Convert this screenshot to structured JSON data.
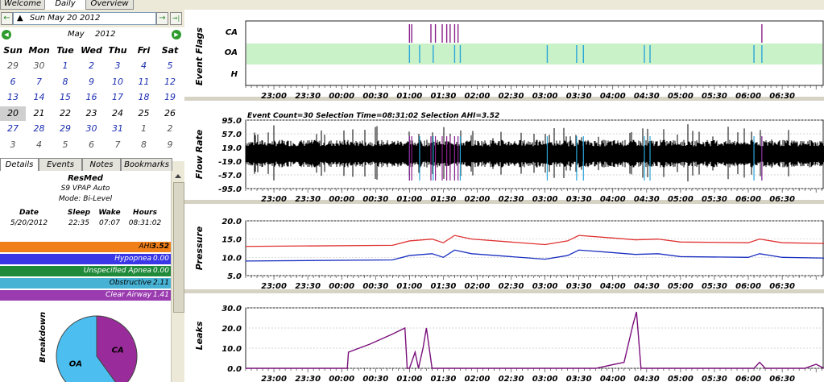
{
  "tabs": [
    "Welcome",
    "Daily",
    "Overview"
  ],
  "date_nav": {
    "date": "Sun May 20 2012",
    "back_glyph": "←",
    "forward_glyph": "→",
    "latest_glyph": "→|",
    "dropdown_glyph": "▲"
  },
  "calendar": {
    "month": "May",
    "year": "2012",
    "prev_glyph": "◀",
    "next_glyph": "▶",
    "dows": [
      "Sun",
      "Mon",
      "Tue",
      "Wed",
      "Thu",
      "Fri",
      "Sat"
    ],
    "weeks": [
      [
        "29",
        "30",
        "1",
        "2",
        "3",
        "4",
        "5"
      ],
      [
        "6",
        "7",
        "8",
        "9",
        "10",
        "11",
        "12"
      ],
      [
        "13",
        "14",
        "15",
        "16",
        "17",
        "18",
        "19"
      ],
      [
        "20",
        "21",
        "22",
        "23",
        "24",
        "25",
        "26"
      ],
      [
        "27",
        "28",
        "29",
        "30",
        "31",
        "1",
        "2"
      ],
      [
        "3",
        "4",
        "5",
        "6",
        "7",
        "8",
        "9"
      ]
    ]
  },
  "detail_tabs": [
    "Details",
    "Events",
    "Notes",
    "Bookmarks"
  ],
  "machine": {
    "brand": "ResMed",
    "model": "S9 VPAP Auto",
    "mode": "Mode: Bi-Level"
  },
  "session": {
    "headers": [
      "Date",
      "Sleep",
      "Wake",
      "Hours"
    ],
    "values": [
      "5/20/2012",
      "22:35",
      "07:07",
      "08:31:02"
    ]
  },
  "indices": [
    {
      "label": "AHI",
      "value": "3.52",
      "color": "#f07f1a"
    },
    {
      "label": "Hypopnea",
      "value": "0.00",
      "color": "#3a38e6"
    },
    {
      "label": "Unspecified Apnea",
      "value": "0.00",
      "color": "#1f8a3a"
    },
    {
      "label": "Obstructive",
      "value": "2.11",
      "color": "#47b2d4"
    },
    {
      "label": "Clear Airway",
      "value": "1.41",
      "color": "#9a3bb0"
    }
  ],
  "breakdown": {
    "title": "Breakdown",
    "chart_data": {
      "type": "pie",
      "slices": [
        {
          "label": "CA",
          "value": 40,
          "color": "#9a2b9a"
        },
        {
          "label": "OA",
          "value": 60,
          "color": "#4cbff0"
        }
      ]
    }
  },
  "x_ticks": [
    "23:00",
    "23:30",
    "00:00",
    "00:30",
    "01:00",
    "01:30",
    "02:00",
    "02:30",
    "03:00",
    "03:30",
    "04:00",
    "04:30",
    "05:00",
    "05:30",
    "06:00",
    "06:30"
  ],
  "flags": {
    "title": "Event Flags",
    "rows": [
      "CA",
      "OA",
      "H"
    ],
    "chart_data": {
      "type": "scatter",
      "ca_times": [
        "01:00",
        "01:02",
        "01:19",
        "01:23",
        "01:29",
        "01:33",
        "01:36",
        "01:40",
        "01:43",
        "06:12"
      ],
      "oa_times": [
        "01:00",
        "01:09",
        "01:21",
        "01:40",
        "01:45",
        "03:02",
        "03:28",
        "03:34",
        "04:28",
        "04:33",
        "06:05",
        "06:12"
      ]
    }
  },
  "flow": {
    "title": "Flow Rate",
    "annotation": "Event Count=30 Selection Time=08:31:02 Selection AHI=3.52",
    "y_ticks": [
      "95.0",
      "57.0",
      "19.0",
      "-19.0",
      "-57.0",
      "-95.0"
    ]
  },
  "pressure": {
    "title": "Pressure",
    "y_ticks": [
      "20.0",
      "15.0",
      "10.0",
      "5.0"
    ],
    "colors": {
      "ipap": "#e03030",
      "epap": "#1a2fc0"
    },
    "chart_data": {
      "type": "line",
      "x": [
        "22:35",
        "00:45",
        "01:00",
        "01:20",
        "01:30",
        "01:40",
        "01:55",
        "03:00",
        "03:20",
        "03:30",
        "04:00",
        "04:20",
        "04:40",
        "05:00",
        "06:00",
        "06:10",
        "06:30",
        "07:07"
      ],
      "series": [
        {
          "values": [
            13.0,
            13.3,
            14.5,
            15.0,
            14.0,
            16.0,
            15.0,
            13.5,
            14.5,
            16.0,
            15.3,
            14.8,
            15.0,
            14.2,
            14.0,
            15.0,
            14.0,
            13.8
          ]
        },
        {
          "values": [
            9.0,
            9.3,
            10.5,
            11.0,
            10.0,
            12.0,
            11.0,
            9.5,
            10.5,
            12.0,
            11.3,
            10.8,
            11.0,
            10.2,
            10.0,
            11.0,
            10.0,
            9.8
          ]
        }
      ]
    }
  },
  "leaks": {
    "title": "Leaks",
    "y_ticks": [
      "30.0",
      "20.0",
      "10.0",
      "0.0"
    ],
    "color": "#7a0f7a",
    "chart_data": {
      "type": "line",
      "x": [
        "22:35",
        "00:05",
        "00:06",
        "00:25",
        "00:45",
        "00:56",
        "00:58",
        "01:00",
        "01:05",
        "01:08",
        "01:12",
        "01:15",
        "01:20",
        "01:22",
        "01:40",
        "03:45",
        "04:10",
        "04:18",
        "04:21",
        "04:25",
        "06:05",
        "06:10",
        "06:15",
        "06:50",
        "07:00",
        "07:07"
      ],
      "values": [
        0,
        0,
        8,
        12,
        17,
        20,
        0,
        0,
        8,
        0,
        10,
        20,
        0,
        0,
        0,
        0,
        3,
        22,
        28,
        0,
        0,
        3,
        0,
        0,
        2,
        0
      ]
    }
  }
}
